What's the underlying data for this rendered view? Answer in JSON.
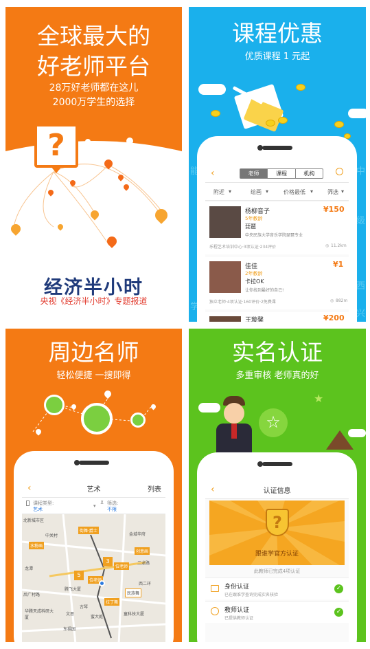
{
  "panel1": {
    "title_line1": "全球最大的",
    "title_line2": "好老师平台",
    "sub_line1": "28万好老师都在这儿",
    "sub_line2": "2000万学生的选择",
    "logo_text": "经济半小时",
    "caption": "央视《经济半小时》专题报道"
  },
  "panel2": {
    "title": "课程优惠",
    "subtitle": "优质课程 1 元起",
    "tabs": [
      "老师",
      "课程",
      "机构"
    ],
    "filters": [
      "附近",
      "绘画",
      "价格最低",
      "筛选"
    ],
    "teachers": [
      {
        "name": "杨柳音子",
        "years": "5年教龄",
        "subject": "琵琶",
        "school": "中央民族大学音乐学院琵琶专业",
        "price": "¥150",
        "unit": "起",
        "footer": "乐程艺术培训中心·3项认证·234评价",
        "distance": "11.2km"
      },
      {
        "name": "佳佳",
        "years": "2年教龄",
        "subject": "卡拉OK",
        "school": "让你找到最好的自己!",
        "price": "¥1",
        "unit": "起",
        "footer": "独立老师·4项认证·160评价·2免费课",
        "distance": "882m"
      },
      {
        "name": "王璇馨",
        "price": "¥200",
        "unit": "起"
      }
    ],
    "bg_chars": [
      "能",
      "中",
      "级",
      "兴",
      "学",
      "西"
    ]
  },
  "panel3": {
    "title": "周边名师",
    "subtitle": "轻松便捷 一搜即得",
    "nav_title": "艺术",
    "nav_right": "列表",
    "course_type_label": "课程类型:",
    "course_type_value": "艺术",
    "filter_label": "筛选:",
    "filter_value": "不限",
    "map_labels": [
      "北新城市区",
      "街舞·爵士",
      "中关村",
      "金城华府",
      "水粉画",
      "创意画",
      "位老师",
      "龙潭",
      "二龙路",
      "位老师",
      "腾飞大厦",
      "西二环",
      "民族舞",
      "拉丁舞",
      "古琴",
      "后广村路",
      "华腾天成科研大厦",
      "文思",
      "蜜大庭",
      "东福园",
      "童科技大厦"
    ],
    "cluster_counts": [
      "5",
      "3"
    ]
  },
  "panel4": {
    "title": "实名认证",
    "subtitle": "多重审核 老师真的好",
    "nav_title": "认证信息",
    "banner_text": "跟谁学官方认证",
    "completed_text": "此教师已完成4项认证",
    "items": [
      {
        "title": "身份认证",
        "desc": "已在跟谁学查询完成实名核验"
      },
      {
        "title": "教师认证",
        "desc": "已提供教师认证"
      }
    ]
  },
  "colors": {
    "orange": "#f47a14",
    "blue": "#1ab0ec",
    "green": "#5cc31e",
    "gold": "#f0a020"
  }
}
